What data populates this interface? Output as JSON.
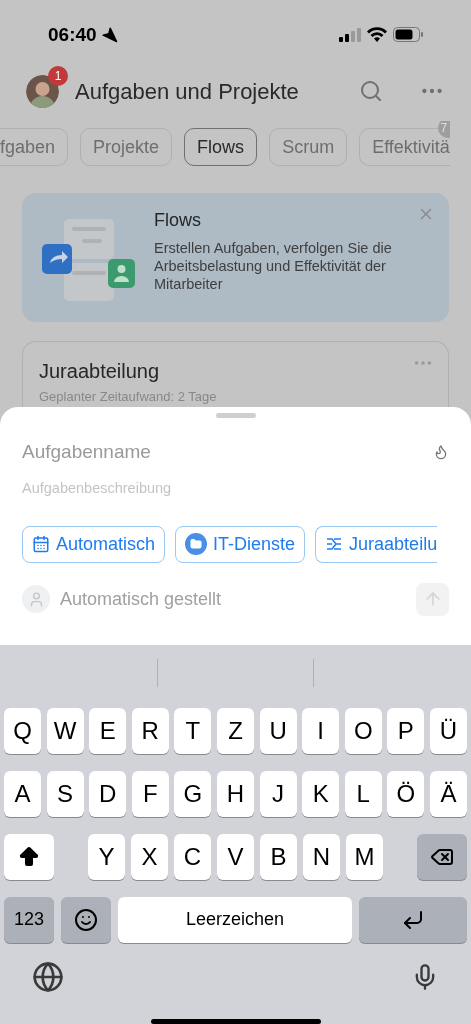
{
  "status_bar": {
    "time": "06:40"
  },
  "header": {
    "title": "Aufgaben und Projekte",
    "avatar_badge": "1"
  },
  "tabs": [
    {
      "label": "fgaben",
      "selected": false
    },
    {
      "label": "Projekte",
      "selected": false
    },
    {
      "label": "Flows",
      "selected": true
    },
    {
      "label": "Scrum",
      "selected": false
    },
    {
      "label": "Effektivitä",
      "selected": false,
      "badge": "7"
    }
  ],
  "banner": {
    "title": "Flows",
    "text": "Erstellen Aufgaben, verfolgen Sie die Arbeitsbelastung und Effektivität der Mitarbeiter"
  },
  "card": {
    "title": "Juraabteilung",
    "subtitle": "Geplanter Zeitaufwand: 2 Tage"
  },
  "sheet": {
    "name_placeholder": "Aufgabenname",
    "description_placeholder": "Aufgabenbeschreibung",
    "chips": [
      {
        "kind": "deadline",
        "label": "Automatisch"
      },
      {
        "kind": "project",
        "label": "IT-Dienste"
      },
      {
        "kind": "flow",
        "label": "Juraabteilu"
      }
    ],
    "assignee": "Automatisch gestellt"
  },
  "keyboard": {
    "top_row": [
      {
        "kind": "letter",
        "label": "Q"
      },
      {
        "kind": "letter",
        "label": "W"
      },
      {
        "kind": "letter",
        "label": "E"
      },
      {
        "kind": "letter",
        "label": "R"
      },
      {
        "kind": "letter",
        "label": "T"
      },
      {
        "kind": "letter",
        "label": "Z"
      },
      {
        "kind": "letter",
        "label": "U"
      },
      {
        "kind": "letter",
        "label": "I"
      },
      {
        "kind": "letter",
        "label": "O"
      },
      {
        "kind": "letter",
        "label": "P"
      },
      {
        "kind": "letter",
        "label": "Ü"
      }
    ],
    "middle_row": [
      {
        "kind": "letter",
        "label": "A"
      },
      {
        "kind": "letter",
        "label": "S"
      },
      {
        "kind": "letter",
        "label": "D"
      },
      {
        "kind": "letter",
        "label": "F"
      },
      {
        "kind": "letter",
        "label": "G"
      },
      {
        "kind": "letter",
        "label": "H"
      },
      {
        "kind": "letter",
        "label": "J"
      },
      {
        "kind": "letter",
        "label": "K"
      },
      {
        "kind": "letter",
        "label": "L"
      },
      {
        "kind": "letter",
        "label": "Ö"
      },
      {
        "kind": "letter",
        "label": "Ä"
      }
    ],
    "shift_row": [
      {
        "kind": "shift",
        "on": true
      },
      {
        "kind": "letter",
        "label": "Y"
      },
      {
        "kind": "letter",
        "label": "X"
      },
      {
        "kind": "letter",
        "label": "C"
      },
      {
        "kind": "letter",
        "label": "V"
      },
      {
        "kind": "letter",
        "label": "B"
      },
      {
        "kind": "letter",
        "label": "N"
      },
      {
        "kind": "letter",
        "label": "M"
      },
      {
        "kind": "delete"
      }
    ],
    "bottom_row": [
      {
        "kind": "numbers",
        "label": "123"
      },
      {
        "kind": "emoji"
      },
      {
        "kind": "space",
        "label": "Leerzeichen"
      },
      {
        "kind": "return"
      }
    ]
  }
}
